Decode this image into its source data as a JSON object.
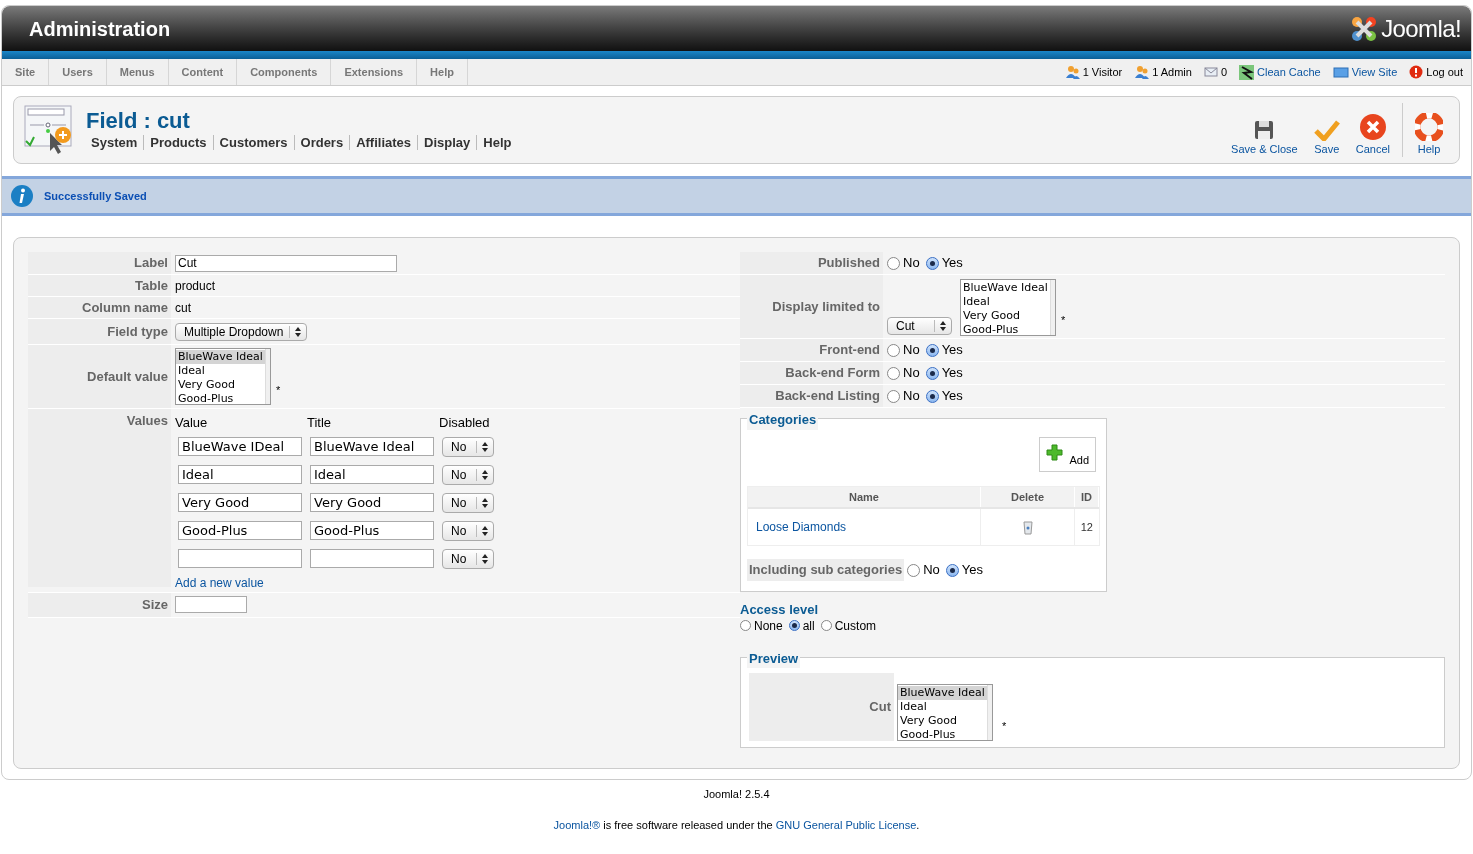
{
  "header": {
    "title": "Administration",
    "logo": "Joomla!"
  },
  "menu": [
    {
      "label": "Site"
    },
    {
      "label": "Users"
    },
    {
      "label": "Menus"
    },
    {
      "label": "Content"
    },
    {
      "label": "Components"
    },
    {
      "label": "Extensions"
    },
    {
      "label": "Help"
    }
  ],
  "status": [
    {
      "kind": "visitors",
      "label": "1 Visitor"
    },
    {
      "kind": "admins",
      "label": "1 Admin"
    },
    {
      "kind": "messages",
      "label": "0"
    },
    {
      "kind": "cache",
      "label": "Clean Cache"
    },
    {
      "kind": "site",
      "label": "View Site"
    },
    {
      "kind": "logout",
      "label": "Log out"
    }
  ],
  "toolbar": {
    "title": "Field : cut",
    "submenu": [
      "System",
      "Products",
      "Customers",
      "Orders",
      "Affiliates",
      "Display",
      "Help"
    ],
    "buttons": [
      {
        "kind": "save_close",
        "label": "Save & Close"
      },
      {
        "kind": "save",
        "label": "Save"
      },
      {
        "kind": "cancel",
        "label": "Cancel"
      },
      {
        "kind": "help",
        "label": "Help"
      }
    ]
  },
  "message": "Successfully Saved",
  "field_form": {
    "label": {
      "caption": "Label",
      "value": "Cut"
    },
    "table": {
      "caption": "Table",
      "value": "product"
    },
    "column_name": {
      "caption": "Column name",
      "value": "cut"
    },
    "field_type": {
      "caption": "Field type",
      "value": "Multiple Dropdown"
    },
    "default_value": {
      "caption": "Default value",
      "required_mark": "*",
      "options": [
        {
          "label": "BlueWave Ideal",
          "selected": true
        },
        {
          "label": "Ideal",
          "selected": false
        },
        {
          "label": "Very Good",
          "selected": false
        },
        {
          "label": "Good-Plus",
          "selected": false
        }
      ]
    },
    "values": {
      "caption": "Values",
      "columns": [
        "Value",
        "Title",
        "Disabled"
      ],
      "rows": [
        {
          "value": "BlueWave IDeal",
          "title": "BlueWave Ideal",
          "disabled": "No"
        },
        {
          "value": "Ideal",
          "title": "Ideal",
          "disabled": "No"
        },
        {
          "value": "Very Good",
          "title": "Very Good",
          "disabled": "No"
        },
        {
          "value": "Good-Plus",
          "title": "Good-Plus",
          "disabled": "No"
        },
        {
          "disabled": "No"
        }
      ],
      "add_link": "Add a new value"
    },
    "size": {
      "caption": "Size"
    }
  },
  "settings": {
    "published": {
      "caption": "Published",
      "options": [
        {
          "label": "No",
          "selected": false
        },
        {
          "label": "Yes",
          "selected": true
        }
      ]
    },
    "display_limited_to": {
      "caption": "Display limited to",
      "field": "Cut",
      "required_mark": "*",
      "options": [
        {
          "label": "BlueWave Ideal",
          "selected": false
        },
        {
          "label": "Ideal",
          "selected": false
        },
        {
          "label": "Very Good",
          "selected": false
        },
        {
          "label": "Good-Plus",
          "selected": false
        }
      ]
    },
    "front_end": {
      "caption": "Front-end",
      "options": [
        {
          "label": "No",
          "selected": false
        },
        {
          "label": "Yes",
          "selected": true
        }
      ]
    },
    "back_end_form": {
      "caption": "Back-end Form",
      "options": [
        {
          "label": "No",
          "selected": false
        },
        {
          "label": "Yes",
          "selected": true
        }
      ]
    },
    "back_end_listing": {
      "caption": "Back-end Listing",
      "options": [
        {
          "label": "No",
          "selected": false
        },
        {
          "label": "Yes",
          "selected": true
        }
      ]
    }
  },
  "categories": {
    "legend": "Categories",
    "add_button": "Add",
    "columns": [
      "Name",
      "Delete",
      "ID"
    ],
    "rows": [
      {
        "name": "Loose Diamonds",
        "id": "12"
      }
    ],
    "sub_categories": {
      "caption": "Including sub categories",
      "options": [
        {
          "label": "No",
          "selected": false
        },
        {
          "label": "Yes",
          "selected": true
        }
      ]
    }
  },
  "access_level": {
    "title": "Access level",
    "options": [
      {
        "label": "None",
        "selected": false
      },
      {
        "label": "all",
        "selected": true
      },
      {
        "label": "Custom",
        "selected": false
      }
    ]
  },
  "preview": {
    "legend": "Preview",
    "caption": "Cut",
    "required_mark": "*",
    "options": [
      {
        "label": "BlueWave Ideal",
        "selected": true
      },
      {
        "label": "Ideal",
        "selected": false
      },
      {
        "label": "Very Good",
        "selected": false
      },
      {
        "label": "Good-Plus",
        "selected": false
      }
    ]
  },
  "footer": {
    "version": "Joomla! 2.5.4",
    "license": [
      {
        "text": "Joomla!®",
        "link": true
      },
      {
        "text": " is free software released under the ",
        "link": false
      },
      {
        "text": "GNU General Public License",
        "link": true
      },
      {
        "text": ".",
        "link": false
      }
    ]
  }
}
